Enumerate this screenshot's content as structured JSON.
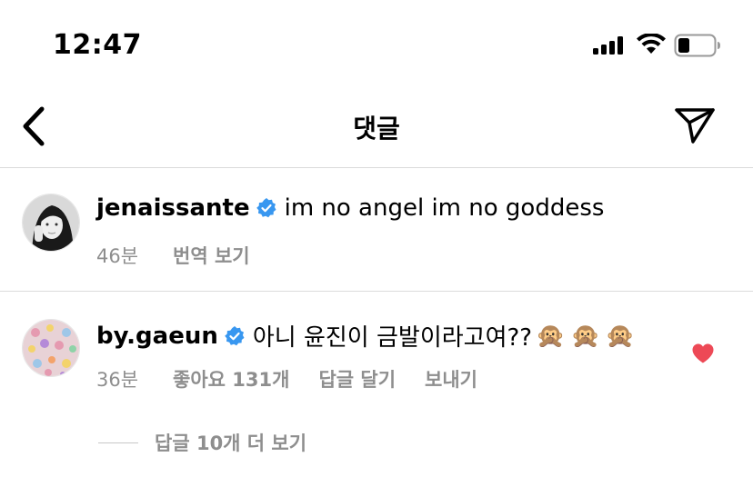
{
  "status_bar": {
    "time": "12:47"
  },
  "nav": {
    "title": "댓글",
    "back_icon": "chevron-left-icon",
    "send_icon": "paper-plane-icon"
  },
  "caption": {
    "username": "jenaissante",
    "verified": true,
    "text": "im no angel im no goddess",
    "time": "46분",
    "translate_label": "번역 보기"
  },
  "reply": {
    "username": "by.gaeun",
    "verified": true,
    "text": "아니 윤진이 금발이라고여??",
    "emojis": [
      "🙊",
      "🙊",
      "🙊"
    ],
    "time": "36분",
    "likes_label": "좋아요 131개",
    "reply_label": "답글 달기",
    "send_label": "보내기",
    "liked": true,
    "view_replies_label": "답글 10개 더 보기"
  },
  "colors": {
    "verified_blue": "#3897f0",
    "heart_red": "#ed4956",
    "meta_gray": "#8e8e8e",
    "divider": "#dbdbdb"
  }
}
